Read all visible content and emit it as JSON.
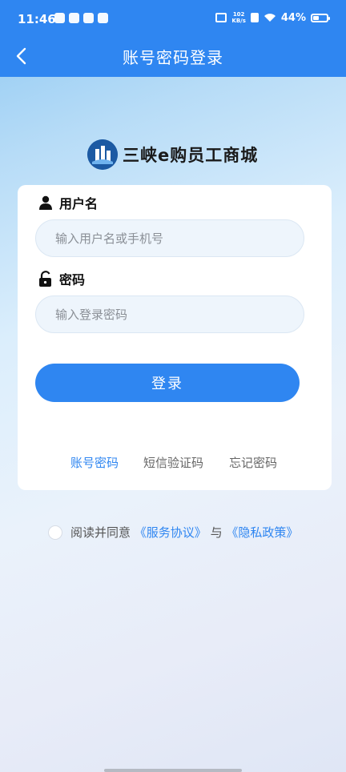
{
  "status": {
    "time": "11:46",
    "net_speed_value": "102",
    "net_speed_unit": "KB/s",
    "battery": "44%",
    "battery_level": 0.44
  },
  "header": {
    "title": "账号密码登录",
    "back_icon": "chevron-left-icon"
  },
  "brand": {
    "name": "三峡e购员工商城",
    "primary_color": "#2f86f1"
  },
  "form": {
    "username_label": "用户名",
    "username_placeholder": "输入用户名或手机号",
    "password_label": "密码",
    "password_placeholder": "输入登录密码",
    "login_button": "登录"
  },
  "tabs": [
    {
      "label": "账号密码",
      "active": true
    },
    {
      "label": "短信验证码",
      "active": false
    },
    {
      "label": "忘记密码",
      "active": false
    }
  ],
  "agreement": {
    "prefix": "阅读并同意",
    "service": "《服务协议》",
    "and": "与",
    "privacy": "《隐私政策》"
  }
}
